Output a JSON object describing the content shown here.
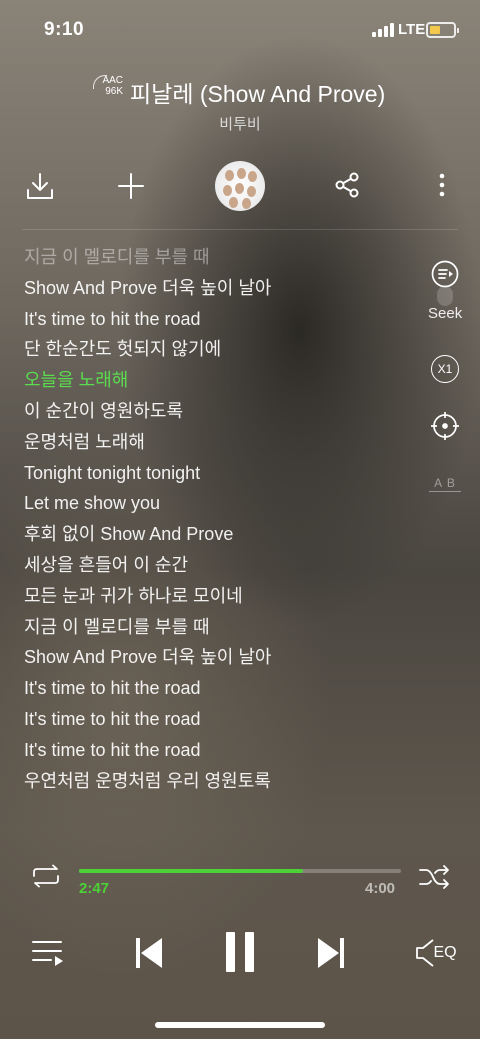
{
  "status_bar": {
    "time": "9:10",
    "network": "LTE",
    "battery_level": 0.35,
    "battery_color": "#f2c94c"
  },
  "header": {
    "quality_top": "AAC",
    "quality_bottom": "96K",
    "title": "피날레 (Show And Prove)",
    "artist": "비투비"
  },
  "actions": {
    "download_icon": "download-icon",
    "add_icon": "plus-icon",
    "share_icon": "share-icon",
    "more_icon": "more-vertical-icon"
  },
  "lyrics": [
    {
      "text": "지금 이 멜로디를 부를 때",
      "state": "faded"
    },
    {
      "text": "Show And Prove 더욱 높이 날아",
      "state": "normal"
    },
    {
      "text": "It's time to hit the road",
      "state": "normal"
    },
    {
      "text": "단 한순간도 헛되지 않기에",
      "state": "normal"
    },
    {
      "text": "오늘을 노래해",
      "state": "active"
    },
    {
      "text": "이 순간이 영원하도록",
      "state": "normal"
    },
    {
      "text": "운명처럼 노래해",
      "state": "normal"
    },
    {
      "text": "Tonight tonight tonight",
      "state": "normal"
    },
    {
      "text": "Let me show you",
      "state": "normal"
    },
    {
      "text": "후회 없이 Show And Prove",
      "state": "normal"
    },
    {
      "text": "세상을 흔들어 이 순간",
      "state": "normal"
    },
    {
      "text": "모든 눈과 귀가 하나로 모이네",
      "state": "normal"
    },
    {
      "text": "지금 이 멜로디를 부를 때",
      "state": "normal"
    },
    {
      "text": "Show And Prove 더욱 높이 날아",
      "state": "normal"
    },
    {
      "text": "It's time to hit the road",
      "state": "normal"
    },
    {
      "text": "It's time to hit the road",
      "state": "normal"
    },
    {
      "text": "It's time to hit the road",
      "state": "normal"
    },
    {
      "text": "우연처럼 운명처럼 우리 영원토록",
      "state": "normal"
    }
  ],
  "side_tools": {
    "seek_label": "Seek",
    "speed_label": "X1",
    "ab_label": "A B"
  },
  "progress": {
    "elapsed": "2:47",
    "total": "4:00",
    "fraction": 0.696,
    "played_color": "#4cd137"
  },
  "controls": {
    "eq_label": "EQ"
  }
}
